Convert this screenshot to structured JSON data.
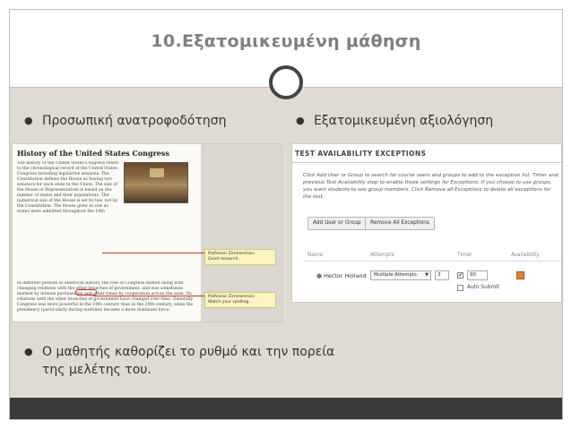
{
  "slide": {
    "title": "10.Εξατομικευμένη μάθηση",
    "bullets": {
      "feedback": "Προσωπική ανατροφοδότηση",
      "assessment": "Εξατομικευμένη αξιολόγηση",
      "pace_line1": "Ο μαθητής καθορίζει το ρυθμό και την πορεία",
      "pace_line2": "της μελέτης του."
    },
    "bullet_glyph": "●"
  },
  "article": {
    "title": "History of the United States Congress",
    "para1": "The history of the United States Congress refers to the chronological record of the United States Congress including legislative sessions. The Constitution defines the House as having two senators for each state in the Union. The size of the House of Representatives is based on the number of states and their populations. The numerical size of the House is set by law, not by the Constitution. The House grew in size as states were admitted throughout the 19th century, and as the nation grew in population. Since the Constitution allows for one representative for as few as 30,000 citizens, Congress passed new, higher limits for the House, which grew in size until a law passed in 1911, based on the National Census of 1910, established the present upper limit of 435 members of the House. Since the House's size was fixed but the population kept growing, instead of a congressperson representing only 30,000 citizens (as the Constitution had previously established), a congressperson represents 600,000 and more persons.",
    "para2": "In different periods of American history, the role of Congress shifted along with changing relations with the other branches of government, and was sometimes marked by intense partisanship and other times by cooperation across the aisle. Its relations with the other branches of government have changed over time. Generally Congress was more powerful in the 19th century than in the 20th century, when the presidency (particularly during wartime) became a more dominant force.",
    "notes": [
      {
        "author": "Professor Zimmerman:",
        "text": "Good research."
      },
      {
        "author": "Professor Zimmerman:",
        "text": "Watch your spelling."
      }
    ]
  },
  "exceptions": {
    "title": "TEST AVAILABILITY EXCEPTIONS",
    "instructions": "Click Add User or Group to search for course users and groups to add to the exception list. Timer and previous Test Availability step to enable those settings for Exceptions. If you choose to use groups, you want students to see group members. Click Remove all Exceptions to delete all exceptions for the test.",
    "buttons": {
      "add": "Add User or Group",
      "remove": "Remove All Exceptions"
    },
    "columns": [
      "Name",
      "Attempts",
      "Timer",
      "Availability"
    ],
    "row": {
      "name": "Hector Holland",
      "attempts_option": "Multiple Attempts",
      "attempts_count": "3",
      "timer_checked": "✔",
      "timer_value": "90",
      "auto_submit_label": "Auto Submit"
    },
    "icons": {
      "user": "user-icon",
      "availability": "calendar-icon"
    },
    "accent": "#d9843c"
  },
  "colors": {
    "content_bg": "#e0dbd2",
    "footer_bg": "#3a3a3a",
    "title_color": "#7f7f7f"
  }
}
